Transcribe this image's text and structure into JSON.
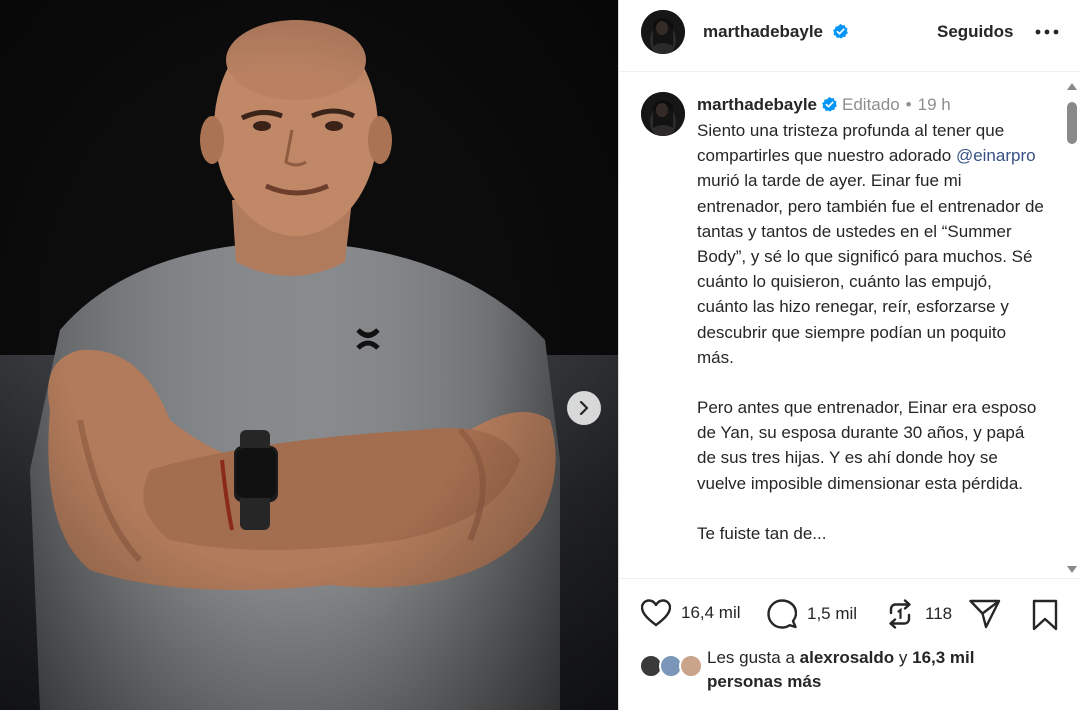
{
  "photo": {
    "description_icon": "photo",
    "shirt_logo_icon": "under-armour-logo-icon",
    "next_icon": "chevron-right-icon"
  },
  "header": {
    "username": "marthadebayle",
    "following_label": "Seguidos",
    "more_icon": "more-horizontal-icon"
  },
  "caption": {
    "username": "marthadebayle",
    "edited": "Editado",
    "separator": "•",
    "time": "19 h",
    "p1_a": "Siento una tristeza profunda al tener que compartirles que nuestro adorado ",
    "mention": "@einarpro",
    "p1_b": " murió la tarde de ayer. Einar fue mi entrenador, pero también fue el entrenador de tantas y tantos de ustedes en el “Summer Body”, y sé lo que significó para muchos. Sé cuánto lo quisieron, cuánto las empujó, cuánto las hizo renegar, reír, esforzarse y descubrir que siempre podían un poquito más.",
    "p2": "Pero antes que entrenador, Einar era esposo de Yan, su esposa durante 30 años, y papá de sus tres hijas. Y es ahí donde hoy se vuelve imposible dimensionar esta pérdida.",
    "p3": "Te fuiste tan de..."
  },
  "actions": {
    "likes": "16,4 mil",
    "comments": "1,5 mil",
    "reposts": "118",
    "like_icon": "heart-icon",
    "comment_icon": "comment-icon",
    "repost_icon": "repost-icon",
    "share_icon": "send-icon",
    "save_icon": "bookmark-icon"
  },
  "liked_by": {
    "prefix": "Les gusta a",
    "user": "alexrosaldo",
    "conj": "y",
    "count": "16,3 mil",
    "suffix": "personas más"
  },
  "colors": {
    "text": "#262626",
    "muted": "#8e8e8e",
    "verified": "#0095f6",
    "mention": "#385185"
  }
}
